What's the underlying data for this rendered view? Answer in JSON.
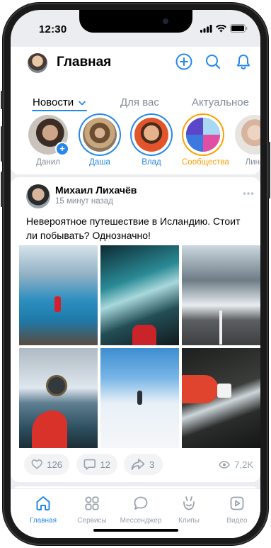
{
  "status": {
    "time": "12:30"
  },
  "header": {
    "title": "Главная"
  },
  "tabs": [
    {
      "label": "Новости"
    },
    {
      "label": "Для вас"
    },
    {
      "label": "Актуальное"
    }
  ],
  "stories": [
    {
      "name": "Данил",
      "ring": "none"
    },
    {
      "name": "Даша",
      "ring": "blue"
    },
    {
      "name": "Влад",
      "ring": "blue"
    },
    {
      "name": "Сообщества",
      "ring": "orange"
    },
    {
      "name": "Лина",
      "ring": "none"
    }
  ],
  "post": {
    "author": "Михаил Лихачёв",
    "time": "15 минут назад",
    "text": "Невероятное путешествие в Исландию. Стоит ли побывать? Однозначно!",
    "likes": "126",
    "comments": "12",
    "shares": "3",
    "views": "7,2K"
  },
  "tabbar": [
    {
      "label": "Главная"
    },
    {
      "label": "Сервисы"
    },
    {
      "label": "Мессенджер"
    },
    {
      "label": "Клипы"
    },
    {
      "label": "Видео"
    }
  ],
  "colors": {
    "accent": "#2688eb",
    "orange": "#ffa000",
    "secondary": "#818c99",
    "background": "#ebedf0"
  }
}
